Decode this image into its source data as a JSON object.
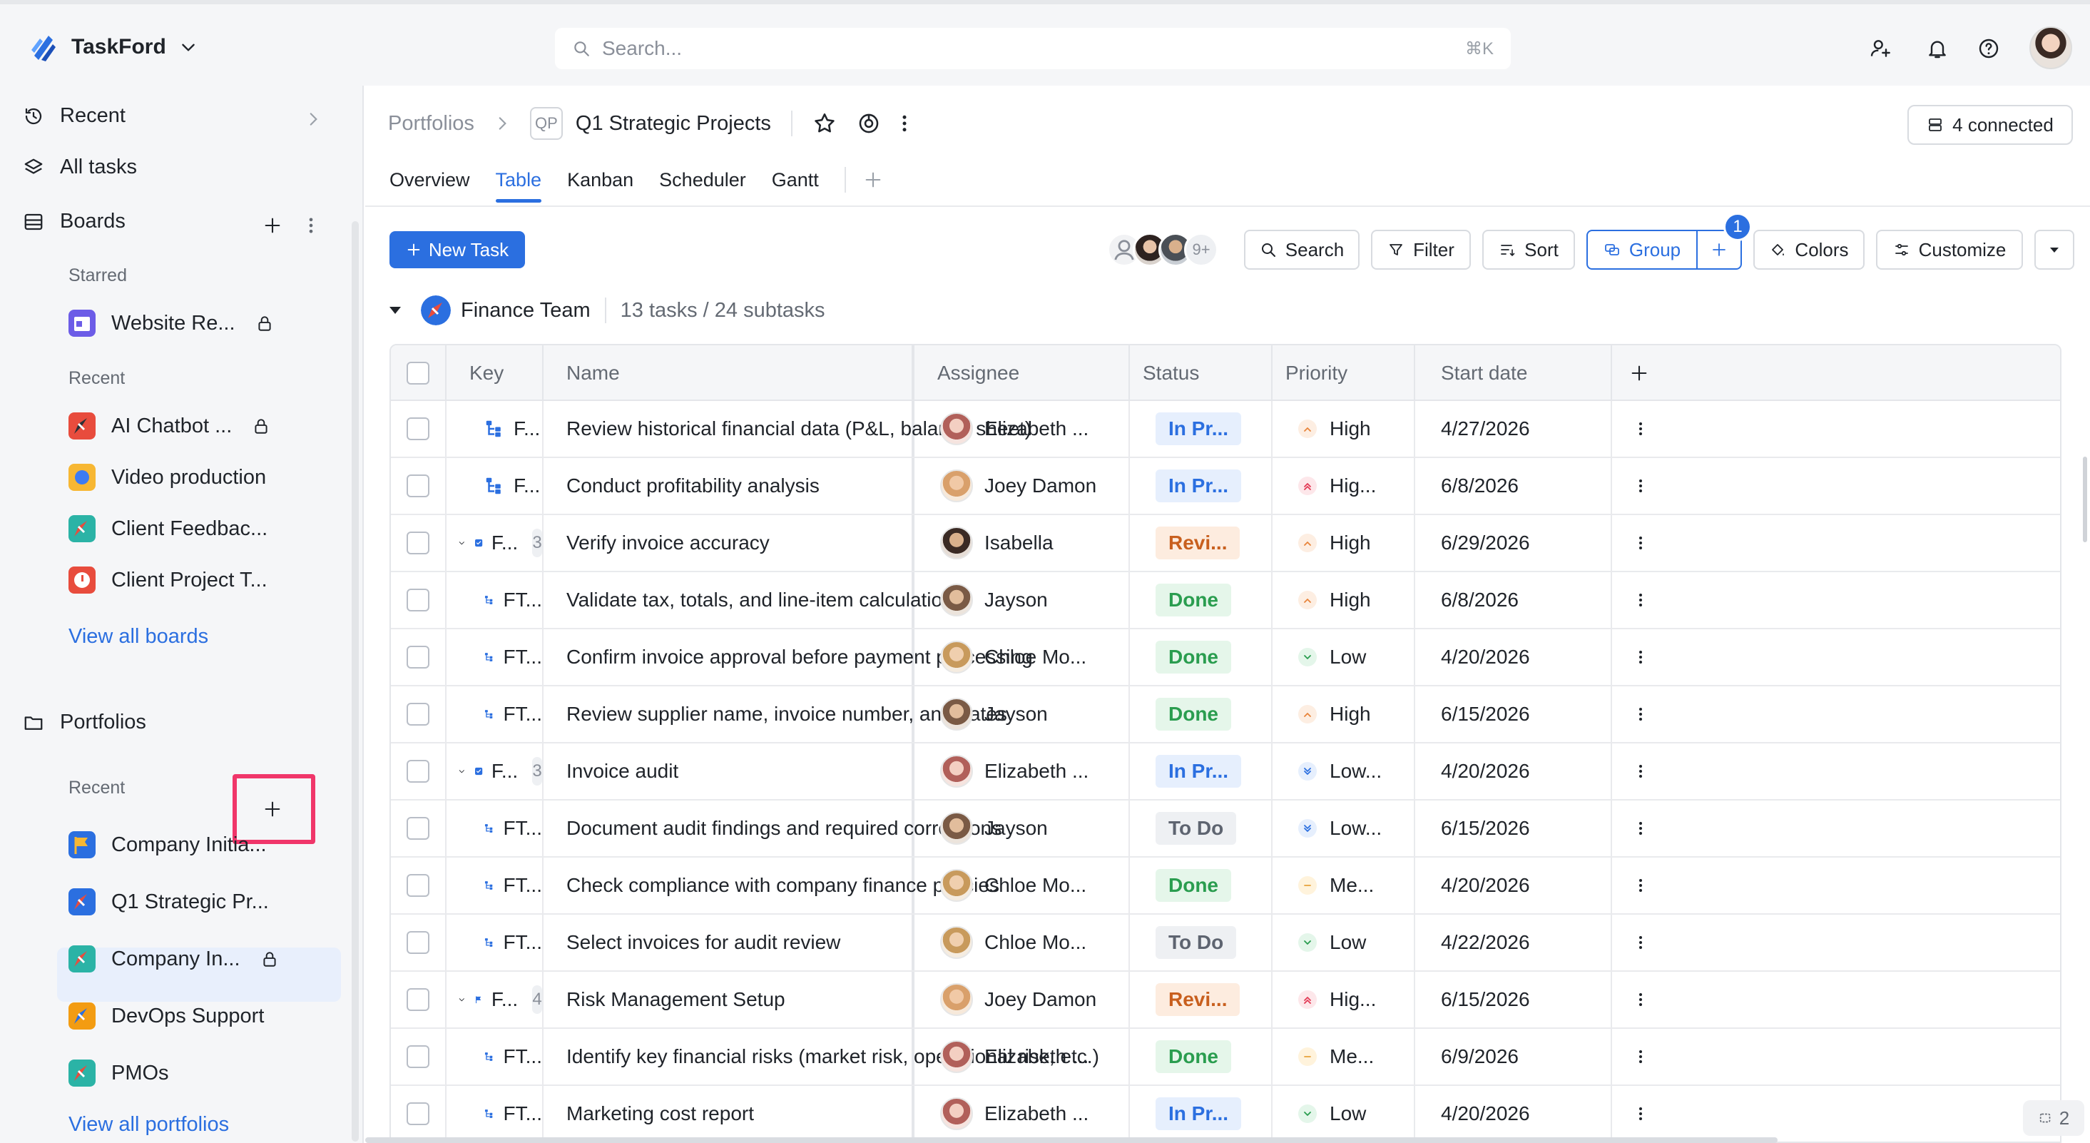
{
  "app": {
    "name": "TaskFord"
  },
  "search": {
    "placeholder": "Search...",
    "shortcut": "⌘K"
  },
  "sidebar": {
    "nav": [
      {
        "label": "Recent"
      },
      {
        "label": "All tasks"
      }
    ],
    "boards": {
      "label": "Boards",
      "starred_label": "Starred",
      "starred": [
        {
          "label": "Website Re...",
          "locked": true
        }
      ],
      "recent_label": "Recent",
      "recent": [
        {
          "label": "AI Chatbot ...",
          "locked": true
        },
        {
          "label": "Video production",
          "locked": false
        },
        {
          "label": "Client Feedbac...",
          "locked": false
        },
        {
          "label": "Client Project T...",
          "locked": false
        }
      ],
      "view_all": "View all boards"
    },
    "portfolios": {
      "label": "Portfolios",
      "recent_label": "Recent",
      "items": [
        {
          "label": "Company Initia...",
          "locked": false
        },
        {
          "label": "Q1 Strategic Pr...",
          "locked": false,
          "active": true
        },
        {
          "label": "Company In...",
          "locked": true
        },
        {
          "label": "DevOps Support",
          "locked": false
        },
        {
          "label": "PMOs",
          "locked": false
        }
      ],
      "view_all": "View all portfolios"
    }
  },
  "header": {
    "breadcrumb_root": "Portfolios",
    "badge": "QP",
    "title": "Q1 Strategic Projects",
    "connected": "4 connected"
  },
  "tabs": [
    "Overview",
    "Table",
    "Kanban",
    "Scheduler",
    "Gantt"
  ],
  "active_tab": "Table",
  "toolbar": {
    "new_task": "New Task",
    "more_people": "9+",
    "search": "Search",
    "filter": "Filter",
    "sort": "Sort",
    "group": "Group",
    "group_badge": "1",
    "colors": "Colors",
    "customize": "Customize"
  },
  "group": {
    "name": "Finance Team",
    "count": "13 tasks / 24 subtasks"
  },
  "table": {
    "columns": [
      "Key",
      "Name",
      "Assignee",
      "Status",
      "Priority",
      "Start date"
    ],
    "rows": [
      {
        "key": "F...",
        "kind": "sub",
        "name": "Review historical financial data (P&L, balance sheet)",
        "assignee": "Elizabeth ...",
        "status": "In Pr...",
        "status_kind": "inpr",
        "priority": "High",
        "priority_kind": "high",
        "start": "4/27/2026"
      },
      {
        "key": "F...",
        "kind": "sub",
        "name": "Conduct profitability analysis",
        "assignee": "Joey Damon",
        "status": "In Pr...",
        "status_kind": "inpr",
        "priority": "Hig...",
        "priority_kind": "highest",
        "start": "6/8/2026"
      },
      {
        "key": "F...",
        "kind": "task",
        "subcount": "3",
        "name": "Verify invoice accuracy",
        "assignee": "Isabella",
        "status": "Revi...",
        "status_kind": "revi",
        "priority": "High",
        "priority_kind": "high",
        "start": "6/29/2026"
      },
      {
        "key": "FT...",
        "kind": "sub",
        "name": "Validate tax, totals, and line-item calculations",
        "assignee": "Jayson",
        "status": "Done",
        "status_kind": "done",
        "priority": "High",
        "priority_kind": "high",
        "start": "6/8/2026"
      },
      {
        "key": "FT...",
        "kind": "sub",
        "name": "Confirm invoice approval before payment processing",
        "assignee": "Chloe Mo...",
        "status": "Done",
        "status_kind": "done",
        "priority": "Low",
        "priority_kind": "low",
        "start": "4/20/2026"
      },
      {
        "key": "FT...",
        "kind": "sub",
        "name": "Review supplier name, invoice number, and dates",
        "assignee": "Jayson",
        "status": "Done",
        "status_kind": "done",
        "priority": "High",
        "priority_kind": "high",
        "start": "6/15/2026"
      },
      {
        "key": "F...",
        "kind": "task",
        "subcount": "3",
        "name": "Invoice audit",
        "assignee": "Elizabeth ...",
        "status": "In Pr...",
        "status_kind": "inpr",
        "priority": "Low...",
        "priority_kind": "lowest",
        "start": "4/20/2026"
      },
      {
        "key": "FT...",
        "kind": "sub",
        "name": "Document audit findings and required corrections",
        "assignee": "Jayson",
        "status": "To Do",
        "status_kind": "todo",
        "priority": "Low...",
        "priority_kind": "lowest",
        "start": "6/15/2026"
      },
      {
        "key": "FT...",
        "kind": "sub",
        "name": "Check compliance with company finance policies",
        "assignee": "Chloe Mo...",
        "status": "Done",
        "status_kind": "done",
        "priority": "Me...",
        "priority_kind": "medium",
        "start": "4/20/2026"
      },
      {
        "key": "FT...",
        "kind": "sub",
        "name": "Select invoices for audit review",
        "assignee": "Chloe Mo...",
        "status": "To Do",
        "status_kind": "todo",
        "priority": "Low",
        "priority_kind": "low",
        "start": "4/22/2026"
      },
      {
        "key": "F...",
        "kind": "flag",
        "subcount": "4",
        "name": "Risk Management Setup",
        "assignee": "Joey Damon",
        "status": "Revi...",
        "status_kind": "revi",
        "priority": "Hig...",
        "priority_kind": "highest",
        "start": "6/15/2026"
      },
      {
        "key": "FT...",
        "kind": "sub",
        "name": "Identify key financial risks (market risk, operational risk, etc.)",
        "assignee": "Elizabeth ...",
        "status": "Done",
        "status_kind": "done",
        "priority": "Me...",
        "priority_kind": "medium",
        "start": "6/9/2026"
      },
      {
        "key": "FT...",
        "kind": "sub",
        "name": "Marketing cost report",
        "assignee": "Elizabeth ...",
        "status": "In Pr...",
        "status_kind": "inpr",
        "priority": "Low",
        "priority_kind": "low",
        "start": "4/20/2026"
      }
    ]
  },
  "footer": {
    "selection_count": "2"
  }
}
